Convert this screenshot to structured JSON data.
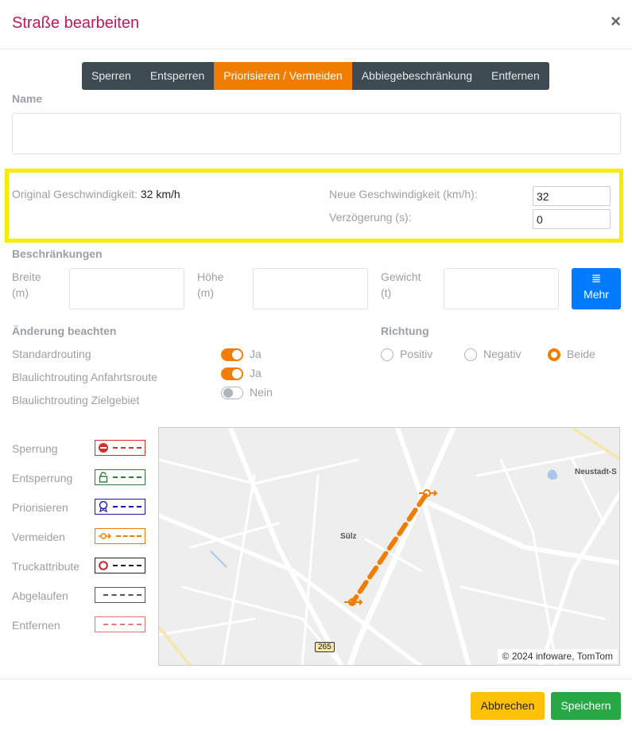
{
  "header": {
    "title": "Straße bearbeiten",
    "close": "×"
  },
  "tabs": [
    {
      "label": "Sperren",
      "active": false
    },
    {
      "label": "Entsperren",
      "active": false
    },
    {
      "label": "Priorisieren / Vermeiden",
      "active": true
    },
    {
      "label": "Abbiegebeschränkung",
      "active": false
    },
    {
      "label": "Entfernen",
      "active": false
    }
  ],
  "name": {
    "label": "Name",
    "value": ""
  },
  "speed": {
    "original_label": "Original Geschwindigkeit:",
    "original_value": "32 km/h",
    "new_label": "Neue Geschwindigkeit (km/h):",
    "new_value": "32",
    "delay_label": "Verzögerung (s):",
    "delay_value": "0"
  },
  "restrictions": {
    "title": "Beschränkungen",
    "width_label_1": "Breite",
    "width_label_2": "(m)",
    "height_label_1": "Höhe",
    "height_label_2": "(m)",
    "weight_label_1": "Gewicht",
    "weight_label_2": "(t)",
    "more_button": "Mehr",
    "more_icon": "list-icon"
  },
  "changes": {
    "title": "Änderung beachten",
    "items": [
      {
        "label": "Standardrouting",
        "state": "Ja",
        "on": true
      },
      {
        "label": "Blaulichtrouting Anfahrtsroute",
        "state": "Ja",
        "on": true
      },
      {
        "label": "Blaulichtrouting Zielgebiet",
        "state": "Nein",
        "on": false
      }
    ]
  },
  "direction": {
    "title": "Richtung",
    "options": [
      {
        "label": "Positiv",
        "checked": false
      },
      {
        "label": "Negativ",
        "checked": false
      },
      {
        "label": "Beide",
        "checked": true
      }
    ]
  },
  "legend": [
    {
      "label": "Sperrung",
      "color": "#d32f2f",
      "icon": "no-entry-icon"
    },
    {
      "label": "Entsperrung",
      "color": "#2e7d32",
      "icon": "unlock-icon"
    },
    {
      "label": "Priorisieren",
      "color": "#1a1aa6",
      "icon": "badge-icon"
    },
    {
      "label": "Vermeiden",
      "color": "#f07d00",
      "icon": "avoid-icon"
    },
    {
      "label": "Truckattribute",
      "color": "#c62828",
      "icon": "circle-icon"
    },
    {
      "label": "Abgelaufen",
      "color": "#555555",
      "icon": "none"
    },
    {
      "label": "Entfernen",
      "color": "#e57373",
      "icon": "none"
    }
  ],
  "map": {
    "place_label_1": "Sülz",
    "place_label_2": "Neustadt-S",
    "road_number": "265",
    "attribution": "© 2024 infoware, TomTom"
  },
  "footer": {
    "cancel": "Abbrechen",
    "save": "Speichern"
  },
  "colors": {
    "accent": "#f07d00",
    "title": "#c2185b",
    "highlight": "#f5ec00",
    "primary": "#007bff",
    "success": "#28a745",
    "warning": "#ffc107"
  }
}
